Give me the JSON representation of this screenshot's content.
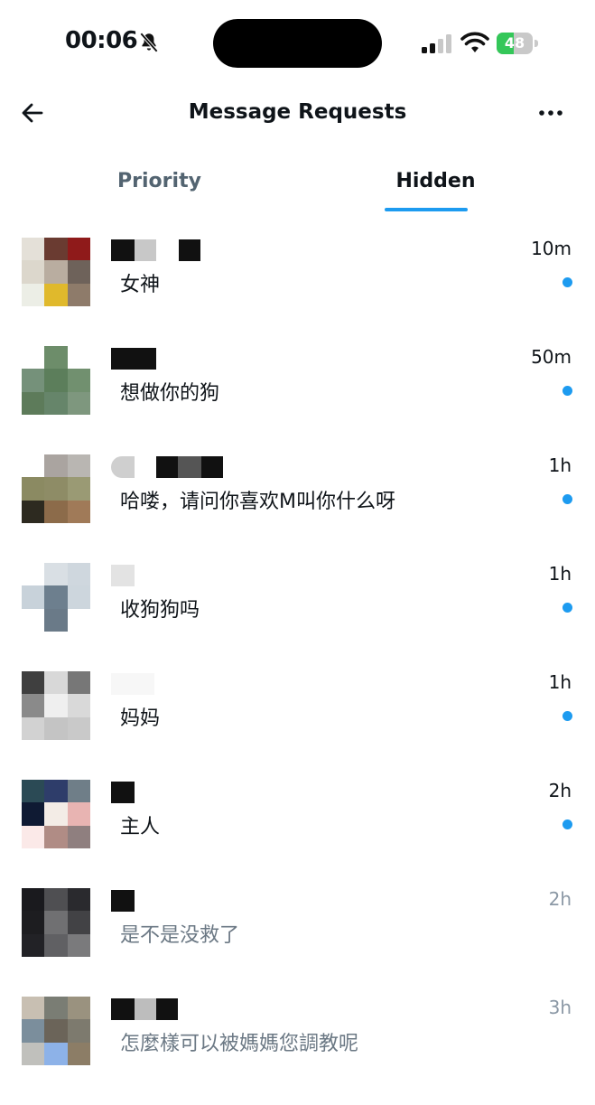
{
  "status_bar": {
    "time": "00:06",
    "battery": "48",
    "battery_level": 0.48
  },
  "header": {
    "title": "Message Requests",
    "back_icon": "arrow-left-icon",
    "more_icon": "more-horizontal-icon"
  },
  "tabs": [
    {
      "label": "Priority",
      "active": false
    },
    {
      "label": "Hidden",
      "active": true
    }
  ],
  "conversations": [
    {
      "time": "10m",
      "preview": "女神",
      "unread": true,
      "avatar_colors": [
        "#e4e0d8",
        "#6a3b31",
        "#8f1a1a",
        "#dcd7cc",
        "#b9ada0",
        "#6e625a",
        "#eceee6",
        "#e0b92c",
        "#8e7b6a"
      ]
    },
    {
      "time": "50m",
      "preview": "想做你的狗",
      "unread": true,
      "avatar_colors": [
        "#ffffff",
        "#6d8d6a",
        "#ffffff",
        "#75917a",
        "#5c7e5b",
        "#71906f",
        "#5d7b5a",
        "#66856a",
        "#7e977e"
      ]
    },
    {
      "time": "1h",
      "preview": "哈喽，请问你喜欢M叫你什么呀",
      "unread": true,
      "avatar_colors": [
        "#ffffff",
        "#aaa4a0",
        "#b9b6b2",
        "#8b8a62",
        "#8e8c66",
        "#9a9a74",
        "#2d2a20",
        "#8c6b4a",
        "#a07a58"
      ]
    },
    {
      "time": "1h",
      "preview": "收狗狗吗",
      "unread": true,
      "avatar_colors": [
        "#ffffff",
        "#d9dfe4",
        "#cfd7de",
        "#c8d2da",
        "#6d7f8e",
        "#cdd6dd",
        "#ffffff",
        "#6a7a88",
        "#ffffff"
      ]
    },
    {
      "time": "1h",
      "preview": "妈妈",
      "unread": true,
      "avatar_colors": [
        "#3f3f3f",
        "#d8d8d8",
        "#777777",
        "#8a8a8a",
        "#efefef",
        "#d9d9d9",
        "#d2d2d2",
        "#c4c4c4",
        "#c9c9c9"
      ]
    },
    {
      "time": "2h",
      "preview": "主人",
      "unread": true,
      "avatar_colors": [
        "#2b4a55",
        "#2e3d6a",
        "#6f7e88",
        "#0f1a33",
        "#f3ece6",
        "#e8b4b2",
        "#fbe9e8",
        "#b08c85",
        "#8f7f7f"
      ]
    },
    {
      "time": "2h",
      "preview": "是不是没救了",
      "unread": false,
      "avatar_colors": [
        "#1a1a1e",
        "#4f4f52",
        "#2a2a2e",
        "#1d1d20",
        "#707072",
        "#424245",
        "#222226",
        "#606063",
        "#7a7a7c"
      ]
    },
    {
      "time": "3h",
      "preview": "怎麼樣可以被媽媽您調教呢",
      "unread": false,
      "avatar_colors": [
        "#c8bfb2",
        "#7a7d74",
        "#9a927f",
        "#7b8e9c",
        "#6b6459",
        "#7d7a6e",
        "#c0c0bc",
        "#8db2e8",
        "#8c7d66"
      ]
    }
  ]
}
